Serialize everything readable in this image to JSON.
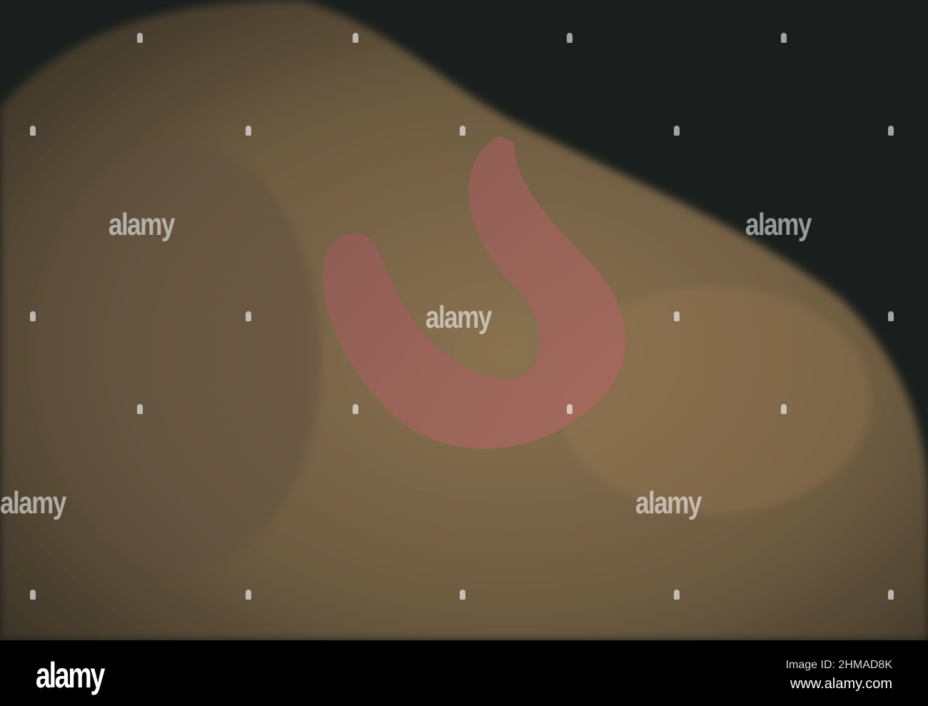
{
  "watermark": {
    "brand": "alamy"
  },
  "footer": {
    "logo": "alamy",
    "image_id": "Image ID: 2HMAD8K",
    "website": "www.alamy.com"
  },
  "colors": {
    "water": "#1a1f1d",
    "rock": "#7a6546",
    "worm": "#a0605a"
  }
}
